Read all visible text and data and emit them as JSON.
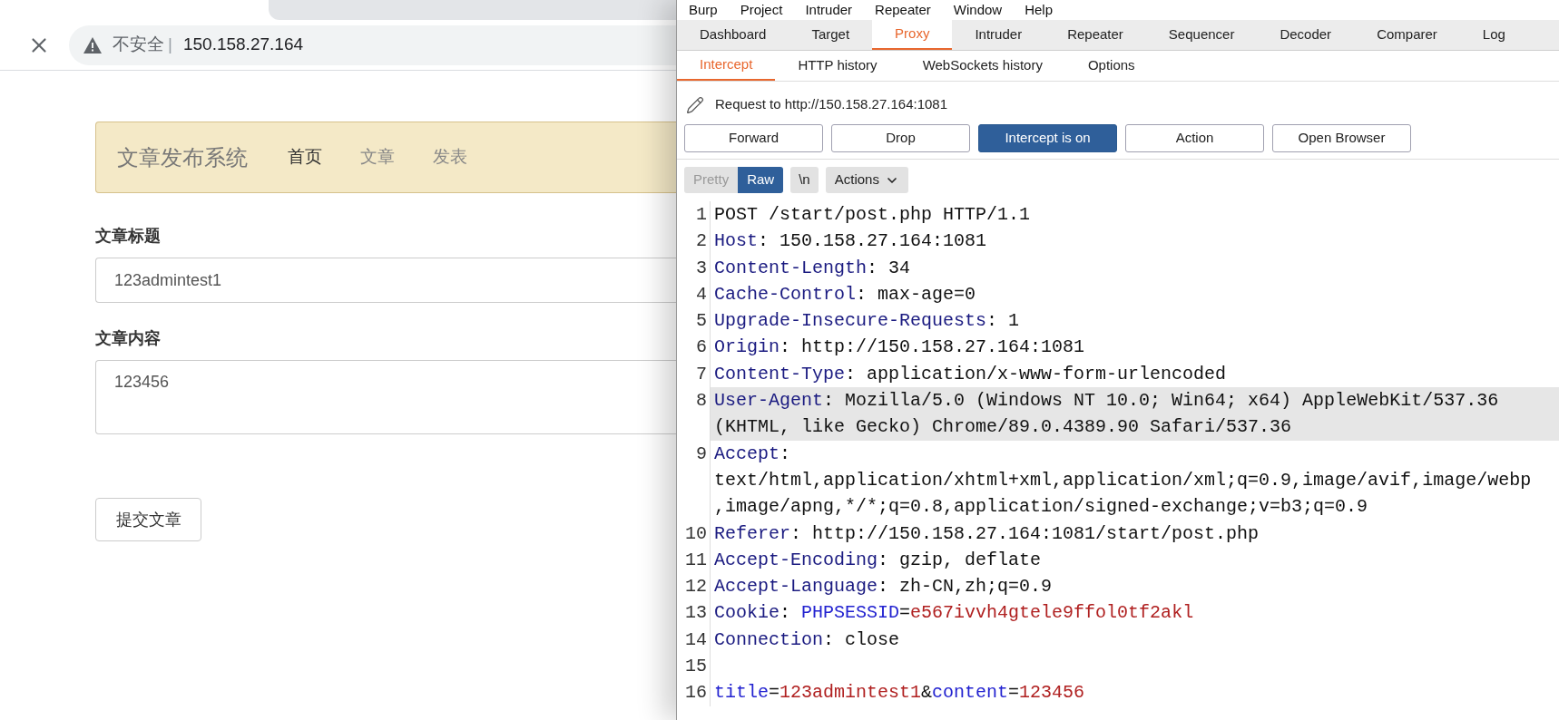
{
  "browser": {
    "address": {
      "security": "不安全",
      "separator": "|",
      "url": "150.158.27.164"
    },
    "page": {
      "brand": "文章发布系统",
      "nav": [
        {
          "label": "首页",
          "selected": true
        },
        {
          "label": "文章",
          "selected": false
        },
        {
          "label": "发表",
          "selected": false
        }
      ],
      "fields": [
        {
          "label": "文章标题",
          "value": "123admintest1",
          "kind": "input"
        },
        {
          "label": "文章内容",
          "value": "123456",
          "kind": "textarea"
        }
      ],
      "submit": "提交文章"
    }
  },
  "burp": {
    "menu": [
      "Burp",
      "Project",
      "Intruder",
      "Repeater",
      "Window",
      "Help"
    ],
    "tabs": [
      {
        "label": "Dashboard",
        "selected": false
      },
      {
        "label": "Target",
        "selected": false
      },
      {
        "label": "Proxy",
        "selected": true
      },
      {
        "label": "Intruder",
        "selected": false
      },
      {
        "label": "Repeater",
        "selected": false
      },
      {
        "label": "Sequencer",
        "selected": false
      },
      {
        "label": "Decoder",
        "selected": false
      },
      {
        "label": "Comparer",
        "selected": false
      },
      {
        "label": "Log",
        "selected": false
      }
    ],
    "subtabs": [
      {
        "label": "Intercept",
        "selected": true
      },
      {
        "label": "HTTP history",
        "selected": false
      },
      {
        "label": "WebSockets history",
        "selected": false
      },
      {
        "label": "Options",
        "selected": false
      }
    ],
    "request_target": "Request to http://150.158.27.164:1081",
    "buttons": [
      {
        "label": "Forward",
        "on": false
      },
      {
        "label": "Drop",
        "on": false
      },
      {
        "label": "Intercept is on",
        "on": true
      },
      {
        "label": "Action",
        "on": false
      },
      {
        "label": "Open Browser",
        "on": false
      }
    ],
    "view_modes": [
      {
        "label": "Pretty",
        "selected": false
      },
      {
        "label": "Raw",
        "selected": true
      }
    ],
    "newline_toggle": "\\n",
    "actions": "Actions",
    "lines": [
      {
        "number": "1",
        "highlighted": false,
        "rows": [
          [
            {
              "kind": "plain",
              "text": "POST /start/post.php HTTP/1.1"
            }
          ]
        ]
      },
      {
        "number": "2",
        "highlighted": false,
        "rows": [
          [
            {
              "kind": "header",
              "text": "Host"
            },
            {
              "kind": "plain",
              "text": ": 150.158.27.164:1081"
            }
          ]
        ]
      },
      {
        "number": "3",
        "highlighted": false,
        "rows": [
          [
            {
              "kind": "header",
              "text": "Content-Length"
            },
            {
              "kind": "plain",
              "text": ": 34"
            }
          ]
        ]
      },
      {
        "number": "4",
        "highlighted": false,
        "rows": [
          [
            {
              "kind": "header",
              "text": "Cache-Control"
            },
            {
              "kind": "plain",
              "text": ": max-age=0"
            }
          ]
        ]
      },
      {
        "number": "5",
        "highlighted": false,
        "rows": [
          [
            {
              "kind": "header",
              "text": "Upgrade-Insecure-Requests"
            },
            {
              "kind": "plain",
              "text": ": 1"
            }
          ]
        ]
      },
      {
        "number": "6",
        "highlighted": false,
        "rows": [
          [
            {
              "kind": "header",
              "text": "Origin"
            },
            {
              "kind": "plain",
              "text": ": http://150.158.27.164:1081"
            }
          ]
        ]
      },
      {
        "number": "7",
        "highlighted": false,
        "rows": [
          [
            {
              "kind": "header",
              "text": "Content-Type"
            },
            {
              "kind": "plain",
              "text": ": application/x-www-form-urlencoded"
            }
          ]
        ]
      },
      {
        "number": "8",
        "highlighted": true,
        "rows": [
          [
            {
              "kind": "header",
              "text": "User-Agent"
            },
            {
              "kind": "plain",
              "text": ": Mozilla/5.0 (Windows NT 10.0; Win64; x64) AppleWebKit/537.36"
            }
          ],
          [
            {
              "kind": "plain",
              "text": "(KHTML, like Gecko) Chrome/89.0.4389.90 Safari/537.36"
            }
          ]
        ]
      },
      {
        "number": "9",
        "highlighted": false,
        "rows": [
          [
            {
              "kind": "header",
              "text": "Accept"
            },
            {
              "kind": "plain",
              "text": ":"
            }
          ],
          [
            {
              "kind": "plain",
              "text": "text/html,application/xhtml+xml,application/xml;q=0.9,image/avif,image/webp"
            }
          ],
          [
            {
              "kind": "plain",
              "text": ",image/apng,*/*;q=0.8,application/signed-exchange;v=b3;q=0.9"
            }
          ]
        ]
      },
      {
        "number": "10",
        "highlighted": false,
        "rows": [
          [
            {
              "kind": "header",
              "text": "Referer"
            },
            {
              "kind": "plain",
              "text": ": http://150.158.27.164:1081/start/post.php"
            }
          ]
        ]
      },
      {
        "number": "11",
        "highlighted": false,
        "rows": [
          [
            {
              "kind": "header",
              "text": "Accept-Encoding"
            },
            {
              "kind": "plain",
              "text": ": gzip, deflate"
            }
          ]
        ]
      },
      {
        "number": "12",
        "highlighted": false,
        "rows": [
          [
            {
              "kind": "header",
              "text": "Accept-Language"
            },
            {
              "kind": "plain",
              "text": ": zh-CN,zh;q=0.9"
            }
          ]
        ]
      },
      {
        "number": "13",
        "highlighted": false,
        "rows": [
          [
            {
              "kind": "header",
              "text": "Cookie"
            },
            {
              "kind": "plain",
              "text": ": "
            },
            {
              "kind": "param",
              "text": "PHPSESSID"
            },
            {
              "kind": "plain",
              "text": "="
            },
            {
              "kind": "value",
              "text": "e567ivvh4gtele9ffol0tf2akl"
            }
          ]
        ]
      },
      {
        "number": "14",
        "highlighted": false,
        "rows": [
          [
            {
              "kind": "header",
              "text": "Connection"
            },
            {
              "kind": "plain",
              "text": ": close"
            }
          ]
        ]
      },
      {
        "number": "15",
        "highlighted": false
      },
      {
        "number": "16",
        "highlighted": false,
        "rows": [
          [
            {
              "kind": "param",
              "text": "title"
            },
            {
              "kind": "plain",
              "text": "="
            },
            {
              "kind": "value",
              "text": "123admintest1"
            },
            {
              "kind": "plain",
              "text": "&"
            },
            {
              "kind": "param",
              "text": "content"
            },
            {
              "kind": "plain",
              "text": "="
            },
            {
              "kind": "value",
              "text": "123456"
            }
          ]
        ]
      }
    ]
  }
}
